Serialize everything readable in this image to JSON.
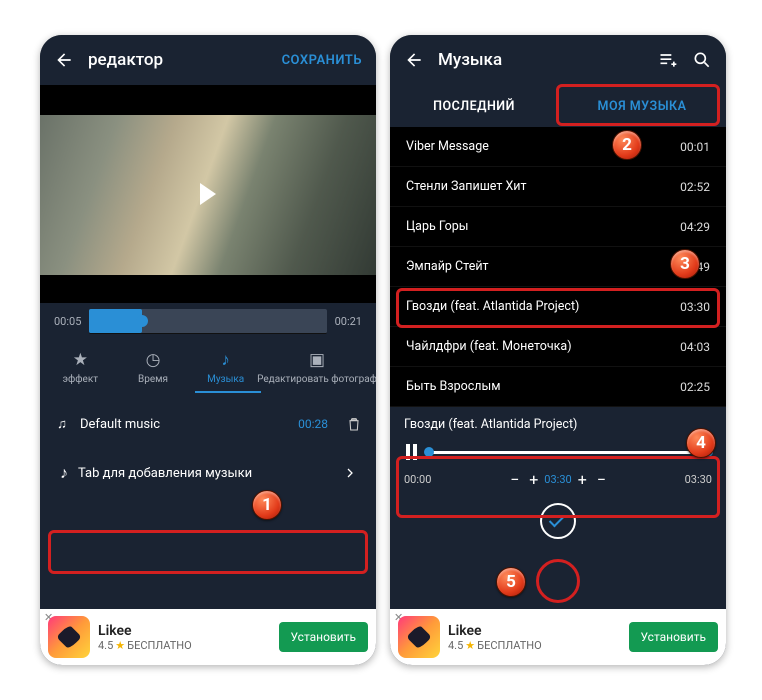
{
  "left": {
    "header": {
      "title": "редактор",
      "save": "СОХРАНИТЬ"
    },
    "scrubber": {
      "start": "00:05",
      "end": "00:21"
    },
    "tabs": {
      "effect": "эффект",
      "time": "Время",
      "music": "Музыка",
      "edit_photo": "Редактировать фотограф"
    },
    "default_music": {
      "label": "Default music",
      "duration": "00:28"
    },
    "add_music_label": "Tab для добавления музыки"
  },
  "right": {
    "header": {
      "title": "Музыка"
    },
    "tabs": {
      "recent": "ПОСЛЕДНИЙ",
      "my_music": "МОЯ МУЗЫКА"
    },
    "tracks": [
      {
        "title": "Viber Message",
        "duration": "00:01"
      },
      {
        "title": "Стенли Запишет Хит",
        "duration": "02:52"
      },
      {
        "title": "Царь Горы",
        "duration": "04:29"
      },
      {
        "title": "Эмпайр Стейт",
        "duration": "02:49"
      },
      {
        "title": "Гвозди (feat. Atlantida Project)",
        "duration": "03:30"
      },
      {
        "title": "Чайлдфри (feat. Монеточка)",
        "duration": "04:03"
      },
      {
        "title": "Быть Взрослым",
        "duration": "02:25"
      }
    ],
    "player": {
      "title": "Гвозди (feat. Atlantida Project)",
      "start": "00:00",
      "mid": "03:30",
      "end": "03:30"
    }
  },
  "ad": {
    "title": "Likee",
    "rating": "4.5",
    "free": "БЕСПЛАТНО",
    "install": "Установить"
  },
  "badges": {
    "b1": "1",
    "b2": "2",
    "b3": "3",
    "b4": "4",
    "b5": "5"
  }
}
